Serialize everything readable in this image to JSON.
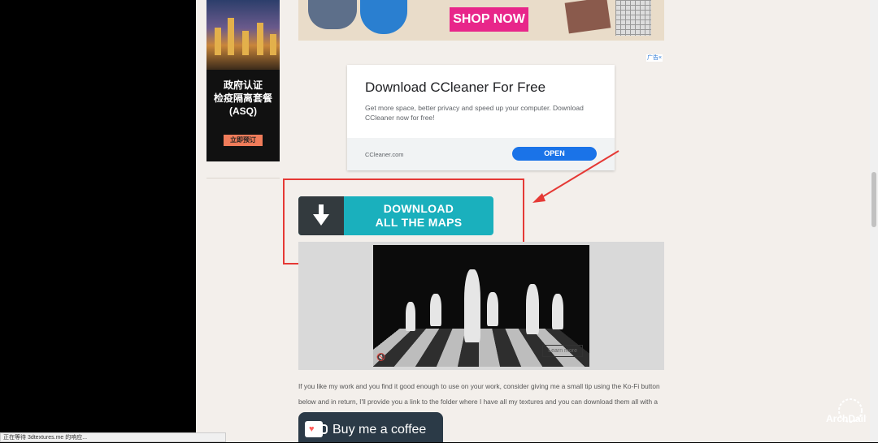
{
  "side_ad": {
    "line1": "政府认证",
    "line2": "检疫隔离套餐",
    "line3": "(ASQ)",
    "button": "立即预订"
  },
  "top_ad": {
    "shop_now": "SHOP NOW"
  },
  "ad_badge": "广告",
  "ad_close": "×",
  "ccleaner_ad": {
    "title": "Download CCleaner For Free",
    "description": "Get more space, better privacy and speed up your computer. Download CCleaner now for free!",
    "url": "CCleaner.com",
    "open": "OPEN"
  },
  "download": {
    "line1": "DOWNLOAD",
    "line2": "ALL THE MAPS"
  },
  "video_ad": {
    "learn_more": "Learn more",
    "mute_icon": "🔇"
  },
  "paragraph": "If you like my work and you find it good enough to use on your work, consider giving me a small tip using the Ko-Fi button below and in return, I'll provide you a link to the folder where I have all my textures and you can download them all with a single click.",
  "coffee": {
    "label": "Buy me a coffee",
    "icon": "♥"
  },
  "status_bar": "正在等待 3dtextures.me 的响应...",
  "watermark": "ArchDaily",
  "colors": {
    "accent": "#1ab0bd",
    "annotation": "#e53935",
    "cta": "#1a73e8"
  }
}
